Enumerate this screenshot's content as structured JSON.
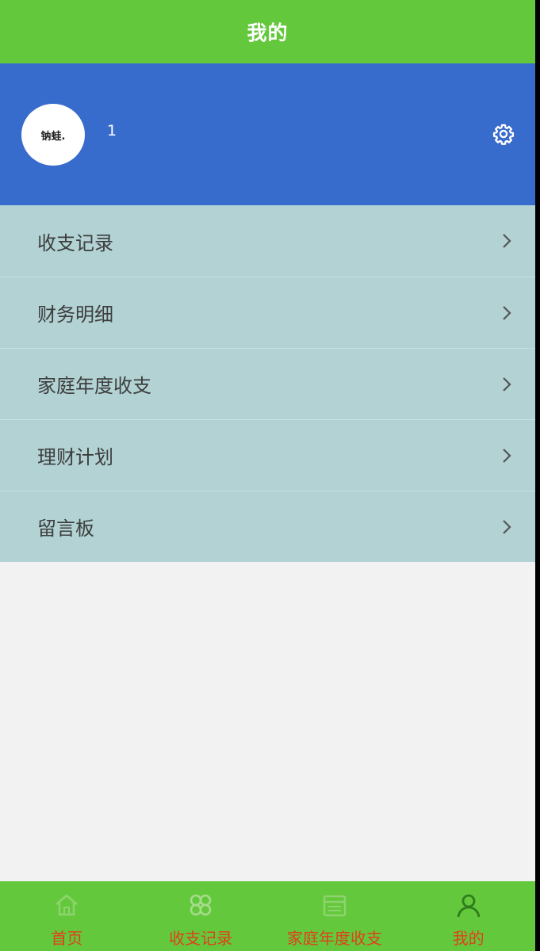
{
  "header": {
    "title": "我的"
  },
  "profile": {
    "avatar_text": "钠蛙.",
    "username": "1"
  },
  "menu": {
    "items": [
      {
        "label": "收支记录"
      },
      {
        "label": "财务明细"
      },
      {
        "label": "家庭年度收支"
      },
      {
        "label": "理财计划"
      },
      {
        "label": "留言板"
      }
    ]
  },
  "tabbar": {
    "tabs": [
      {
        "label": "首页",
        "icon": "home-icon"
      },
      {
        "label": "收支记录",
        "icon": "grid-icon"
      },
      {
        "label": "家庭年度收支",
        "icon": "calendar-icon"
      },
      {
        "label": "我的",
        "icon": "user-icon"
      }
    ]
  },
  "colors": {
    "title_bar": "#64c83c",
    "profile_bg": "#386ccc",
    "menu_bg": "#b2d2d4",
    "tab_label": "#e0401a",
    "page_bg": "#f2f2f2"
  }
}
